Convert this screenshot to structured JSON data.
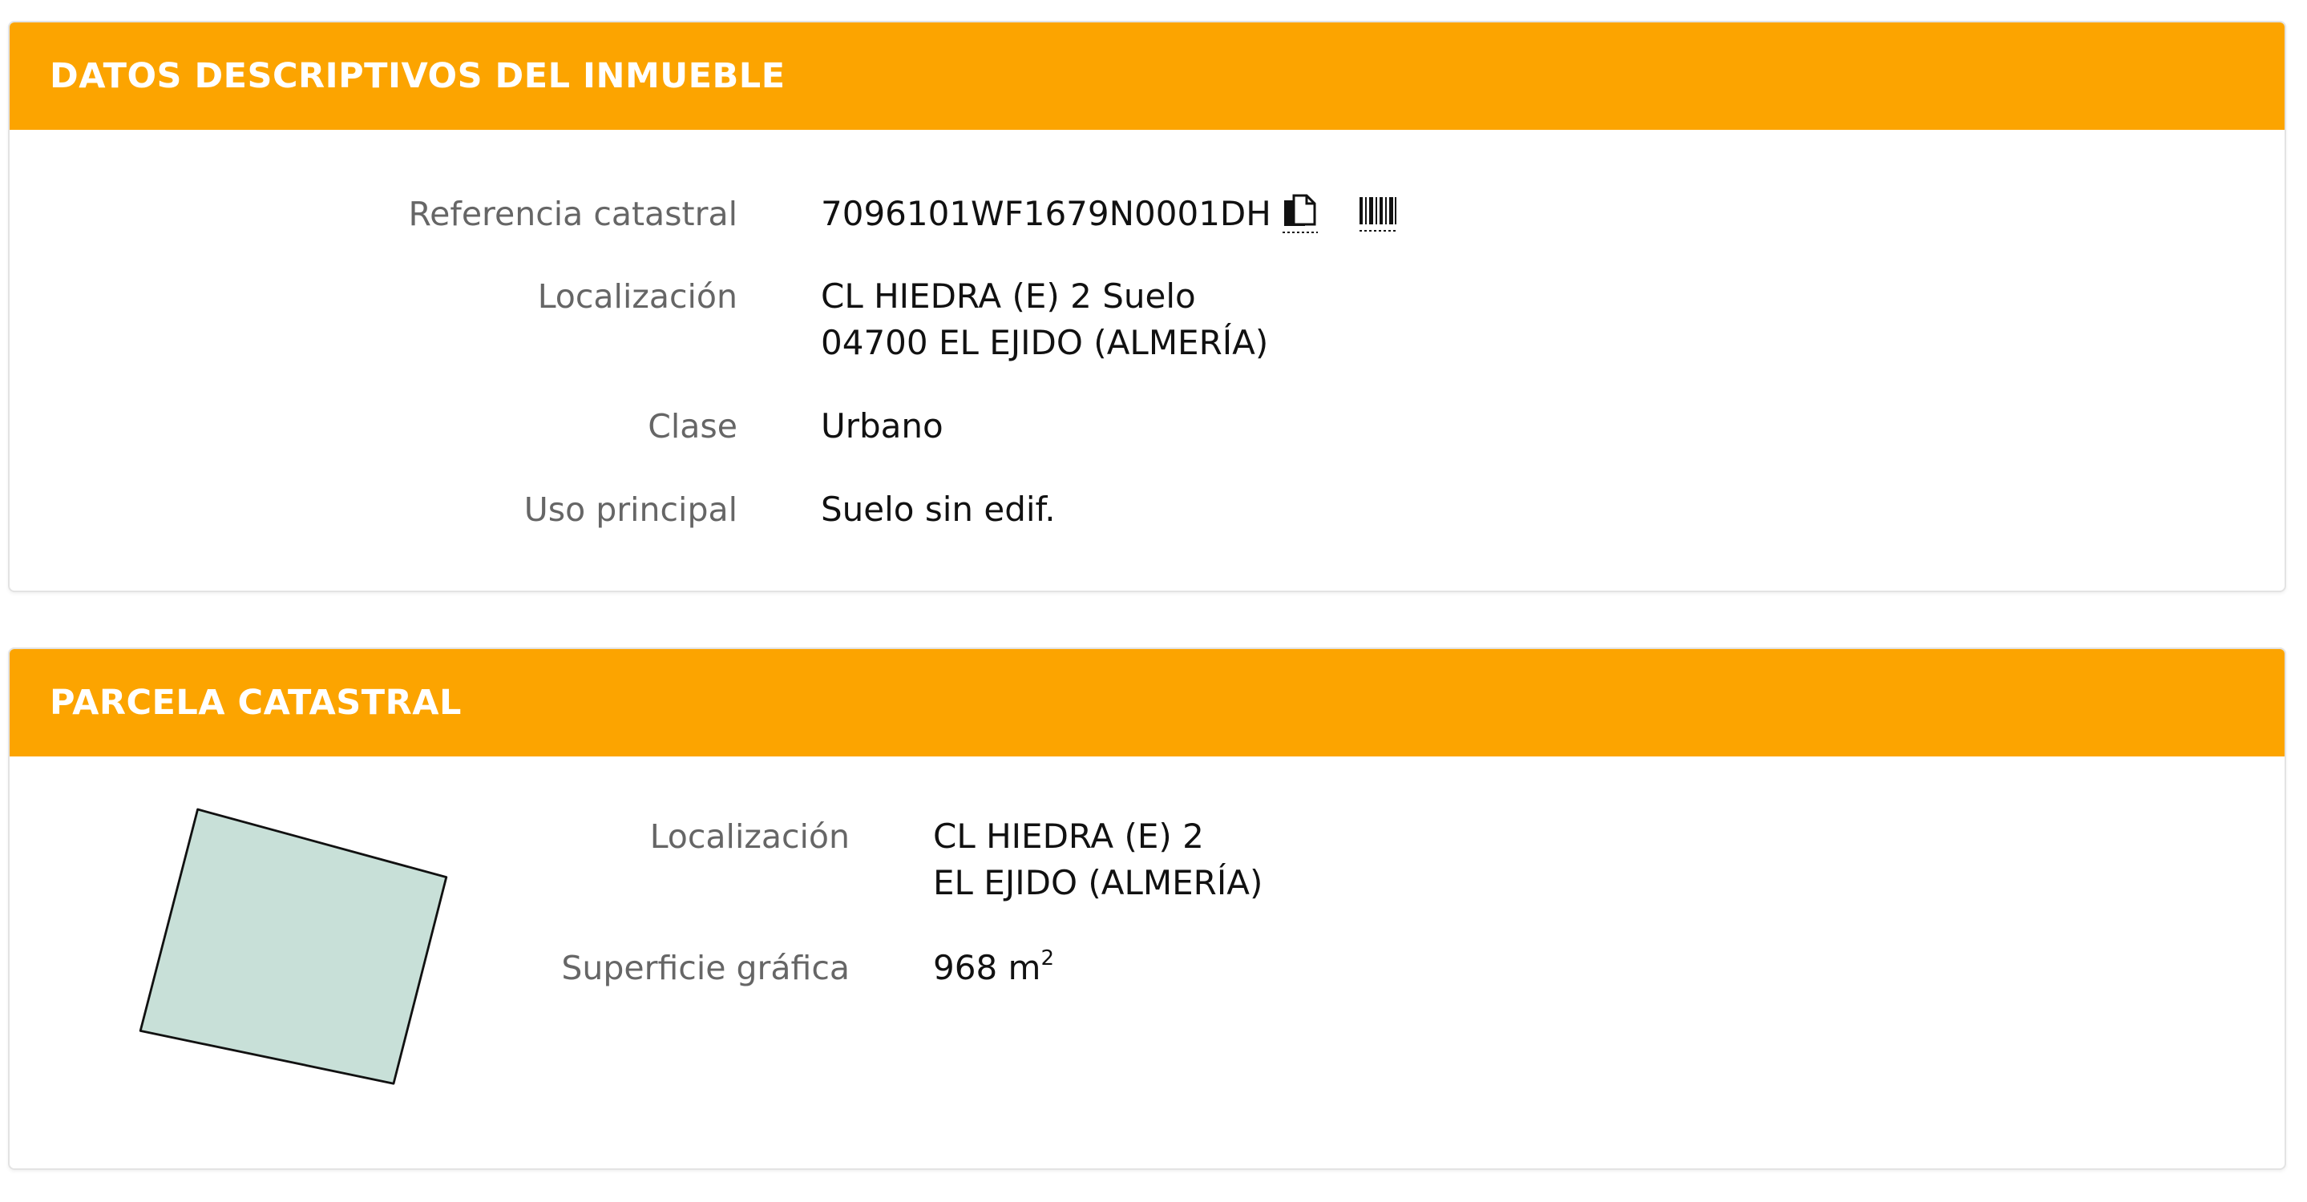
{
  "descriptive": {
    "title": "DATOS DESCRIPTIVOS DEL INMUEBLE",
    "referencia_label": "Referencia catastral",
    "referencia_value": "7096101WF1679N0001DH",
    "localizacion_label": "Localización",
    "localizacion_line1": "CL HIEDRA (E) 2 Suelo",
    "localizacion_line2": "04700 EL EJIDO (ALMERÍA)",
    "clase_label": "Clase",
    "clase_value": "Urbano",
    "uso_label": "Uso principal",
    "uso_value": "Suelo sin edif."
  },
  "parcela": {
    "title": "PARCELA CATASTRAL",
    "localizacion_label": "Localización",
    "localizacion_line1": "CL HIEDRA (E) 2",
    "localizacion_line2": "EL EJIDO (ALMERÍA)",
    "superficie_label": "Superficie gráfica",
    "superficie_number": "968 m",
    "superficie_exponent": "2"
  },
  "icons": {
    "copy": "copy-icon",
    "barcode": "barcode-icon"
  },
  "colors": {
    "header_bg": "#fca400",
    "header_text": "#ffffff",
    "label_text": "#666666",
    "value_text": "#111111",
    "parcel_fill": "#c8e0d8",
    "parcel_stroke": "#111111"
  }
}
